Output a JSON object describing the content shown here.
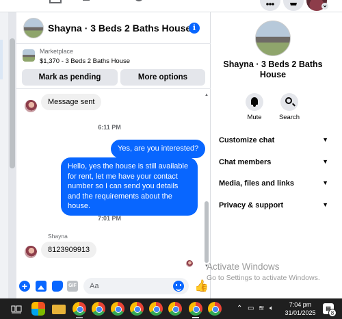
{
  "chat": {
    "title": "Shayna · 3 Beds 2 Baths House",
    "info_icon": "info-icon"
  },
  "marketplace": {
    "label": "Marketplace",
    "price_title": "$1,370 - 3 Beds 2 Baths House",
    "mark_pending": "Mark as pending",
    "more_options": "More options"
  },
  "messages": {
    "msg1": "Message sent",
    "time1": "6:11 PM",
    "msg2": "Yes, are you interested?",
    "msg3": "Hello, yes the house is still available for rent, let me have your contact number so I can send you details and the requirements about the house.",
    "time2": "7:01 PM",
    "sender": "Shayna",
    "msg4": "8123909913"
  },
  "composer": {
    "placeholder": "Aa"
  },
  "info_panel": {
    "name": "Shayna · 3 Beds 2 Baths House",
    "mute": "Mute",
    "search": "Search",
    "sections": [
      "Customize chat",
      "Chat members",
      "Media, files and links",
      "Privacy & support"
    ]
  },
  "watermark": {
    "line1": "Activate Windows",
    "line2": "Go to Settings to activate Windows."
  },
  "taskbar": {
    "time": "7:04 pm",
    "date": "31/01/2025",
    "notifications": "8"
  },
  "colors": {
    "accent": "#0866ff",
    "bubble_in": "#f0f0f0",
    "taskbar": "#1f1f1f"
  }
}
